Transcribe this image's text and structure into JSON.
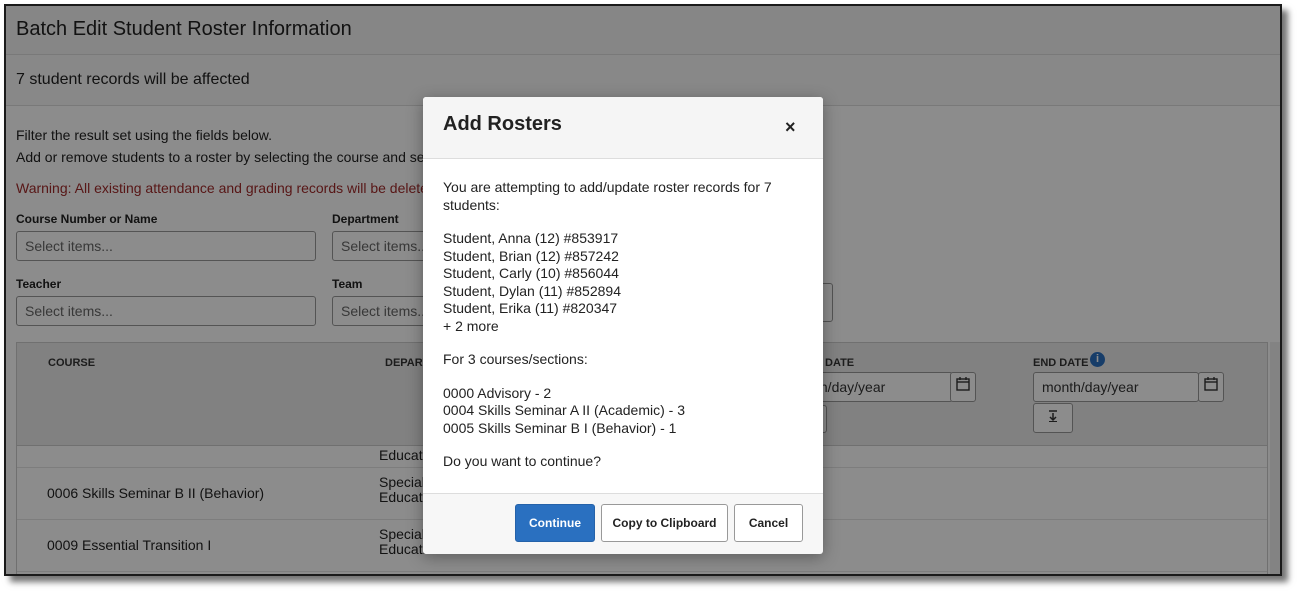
{
  "page": {
    "title": "Batch Edit Student Roster Information",
    "affected": "7 student records will be affected",
    "intro_line1": "Filter the result set using the fields below.",
    "intro_line2": "Add or remove students to a roster by selecting the course and se",
    "warning": "Warning: All existing attendance and grading records will be delete"
  },
  "filters": {
    "course_label": "Course Number or Name",
    "course_placeholder": "Select items...",
    "department_label": "Department",
    "department_placeholder": "Select items...",
    "teacher_label": "Teacher",
    "teacher_placeholder": "Select items...",
    "team_label": "Team",
    "team_placeholder": "Select items..."
  },
  "grid": {
    "col_course": "COURSE",
    "col_department": "DEPART",
    "col_start_date": "DATE",
    "col_end_date": "END DATE",
    "date_placeholder": "month/day/year",
    "start_date_partial": "th/day/year",
    "rows": [
      {
        "course": "0006 Skills Seminar B II (Behavior)",
        "department_l1": "Special",
        "department_l2": "Educatio"
      },
      {
        "course": "0009 Essential Transition I",
        "department_l1": "Special",
        "department_l2": "Education"
      }
    ],
    "partial_row_department": "Educati"
  },
  "modal": {
    "title": "Add Rosters",
    "close": "×",
    "intro": "You are attempting to add/update roster records for 7 students:",
    "students": [
      "Student, Anna (12) #853917",
      "Student, Brian (12) #857242",
      "Student, Carly (10) #856044",
      "Student, Dylan (11) #852894",
      "Student, Erika (11) #820347",
      "+ 2 more"
    ],
    "courses_intro": "For 3 courses/sections:",
    "courses": [
      "0000 Advisory - 2",
      "0004 Skills Seminar A II (Academic) - 3",
      "0005 Skills Seminar B I (Behavior) - 1"
    ],
    "question": "Do you want to continue?",
    "continue_label": "Continue",
    "copy_label": "Copy to Clipboard",
    "cancel_label": "Cancel"
  },
  "icons": {
    "calendar": "calendar-icon",
    "info": "info-icon",
    "fill_down": "fill-down-icon",
    "close": "close-icon"
  },
  "colors": {
    "primary": "#2a70c0",
    "warning": "#a12a2a",
    "info": "#2a70c0"
  }
}
